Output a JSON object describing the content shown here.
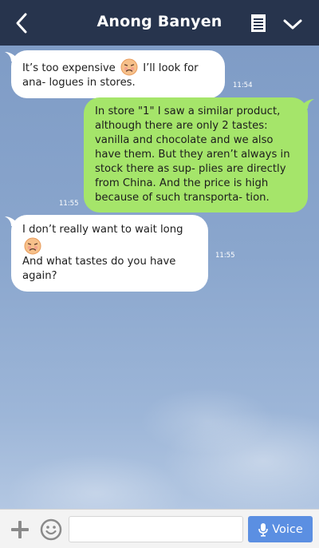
{
  "header": {
    "title": "Anong Banyen",
    "back_icon": "chevron-left-icon",
    "notes_icon": "notes-icon",
    "menu_icon": "chevron-down-icon"
  },
  "messages": [
    {
      "direction": "incoming",
      "text_before_emoji": "It’s too expensive",
      "emoji": "sad-face-emoji",
      "text_after_emoji": " I’ll look for ana- logues in stores.",
      "time": "11:54"
    },
    {
      "direction": "outgoing",
      "text": "In store \"1\" I saw a similar product, although there are only 2 tastes: vanilla and chocolate and we also have them. But they aren’t always in stock there as sup- plies are directly from China. And the price is high because of such transporta- tion.",
      "time": "11:55"
    },
    {
      "direction": "incoming",
      "line1": "I don’t really want to wait long",
      "emoji": "sad-face-emoji",
      "line2": "And what tastes do you have again?",
      "time": "11:55"
    }
  ],
  "composer": {
    "input_value": "",
    "voice_label": "Voice",
    "plus_icon": "plus-icon",
    "sticker_icon": "smiley-icon",
    "mic_icon": "microphone-icon"
  },
  "colors": {
    "header_bg": "#27344d",
    "incoming_bubble": "#ffffff",
    "outgoing_bubble": "#a5e56a",
    "voice_button": "#5b8fe2"
  }
}
